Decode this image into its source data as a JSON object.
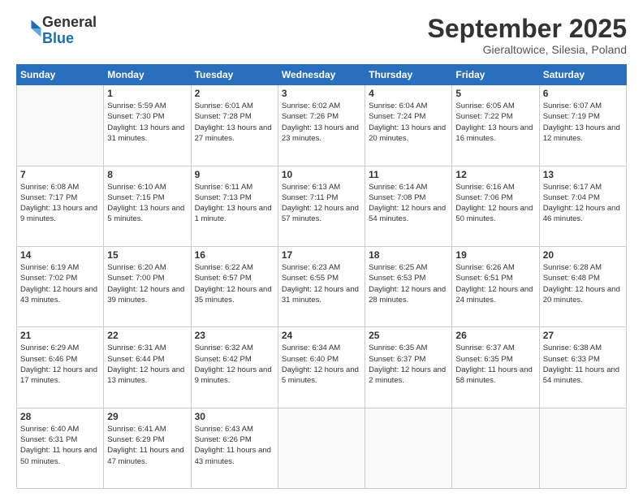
{
  "logo": {
    "text1": "General",
    "text2": "Blue"
  },
  "header": {
    "month": "September 2025",
    "location": "Gieraltowice, Silesia, Poland"
  },
  "weekdays": [
    "Sunday",
    "Monday",
    "Tuesday",
    "Wednesday",
    "Thursday",
    "Friday",
    "Saturday"
  ],
  "weeks": [
    [
      {
        "day": "",
        "sunrise": "",
        "sunset": "",
        "daylight": ""
      },
      {
        "day": "1",
        "sunrise": "Sunrise: 5:59 AM",
        "sunset": "Sunset: 7:30 PM",
        "daylight": "Daylight: 13 hours and 31 minutes."
      },
      {
        "day": "2",
        "sunrise": "Sunrise: 6:01 AM",
        "sunset": "Sunset: 7:28 PM",
        "daylight": "Daylight: 13 hours and 27 minutes."
      },
      {
        "day": "3",
        "sunrise": "Sunrise: 6:02 AM",
        "sunset": "Sunset: 7:26 PM",
        "daylight": "Daylight: 13 hours and 23 minutes."
      },
      {
        "day": "4",
        "sunrise": "Sunrise: 6:04 AM",
        "sunset": "Sunset: 7:24 PM",
        "daylight": "Daylight: 13 hours and 20 minutes."
      },
      {
        "day": "5",
        "sunrise": "Sunrise: 6:05 AM",
        "sunset": "Sunset: 7:22 PM",
        "daylight": "Daylight: 13 hours and 16 minutes."
      },
      {
        "day": "6",
        "sunrise": "Sunrise: 6:07 AM",
        "sunset": "Sunset: 7:19 PM",
        "daylight": "Daylight: 13 hours and 12 minutes."
      }
    ],
    [
      {
        "day": "7",
        "sunrise": "Sunrise: 6:08 AM",
        "sunset": "Sunset: 7:17 PM",
        "daylight": "Daylight: 13 hours and 9 minutes."
      },
      {
        "day": "8",
        "sunrise": "Sunrise: 6:10 AM",
        "sunset": "Sunset: 7:15 PM",
        "daylight": "Daylight: 13 hours and 5 minutes."
      },
      {
        "day": "9",
        "sunrise": "Sunrise: 6:11 AM",
        "sunset": "Sunset: 7:13 PM",
        "daylight": "Daylight: 13 hours and 1 minute."
      },
      {
        "day": "10",
        "sunrise": "Sunrise: 6:13 AM",
        "sunset": "Sunset: 7:11 PM",
        "daylight": "Daylight: 12 hours and 57 minutes."
      },
      {
        "day": "11",
        "sunrise": "Sunrise: 6:14 AM",
        "sunset": "Sunset: 7:08 PM",
        "daylight": "Daylight: 12 hours and 54 minutes."
      },
      {
        "day": "12",
        "sunrise": "Sunrise: 6:16 AM",
        "sunset": "Sunset: 7:06 PM",
        "daylight": "Daylight: 12 hours and 50 minutes."
      },
      {
        "day": "13",
        "sunrise": "Sunrise: 6:17 AM",
        "sunset": "Sunset: 7:04 PM",
        "daylight": "Daylight: 12 hours and 46 minutes."
      }
    ],
    [
      {
        "day": "14",
        "sunrise": "Sunrise: 6:19 AM",
        "sunset": "Sunset: 7:02 PM",
        "daylight": "Daylight: 12 hours and 43 minutes."
      },
      {
        "day": "15",
        "sunrise": "Sunrise: 6:20 AM",
        "sunset": "Sunset: 7:00 PM",
        "daylight": "Daylight: 12 hours and 39 minutes."
      },
      {
        "day": "16",
        "sunrise": "Sunrise: 6:22 AM",
        "sunset": "Sunset: 6:57 PM",
        "daylight": "Daylight: 12 hours and 35 minutes."
      },
      {
        "day": "17",
        "sunrise": "Sunrise: 6:23 AM",
        "sunset": "Sunset: 6:55 PM",
        "daylight": "Daylight: 12 hours and 31 minutes."
      },
      {
        "day": "18",
        "sunrise": "Sunrise: 6:25 AM",
        "sunset": "Sunset: 6:53 PM",
        "daylight": "Daylight: 12 hours and 28 minutes."
      },
      {
        "day": "19",
        "sunrise": "Sunrise: 6:26 AM",
        "sunset": "Sunset: 6:51 PM",
        "daylight": "Daylight: 12 hours and 24 minutes."
      },
      {
        "day": "20",
        "sunrise": "Sunrise: 6:28 AM",
        "sunset": "Sunset: 6:48 PM",
        "daylight": "Daylight: 12 hours and 20 minutes."
      }
    ],
    [
      {
        "day": "21",
        "sunrise": "Sunrise: 6:29 AM",
        "sunset": "Sunset: 6:46 PM",
        "daylight": "Daylight: 12 hours and 17 minutes."
      },
      {
        "day": "22",
        "sunrise": "Sunrise: 6:31 AM",
        "sunset": "Sunset: 6:44 PM",
        "daylight": "Daylight: 12 hours and 13 minutes."
      },
      {
        "day": "23",
        "sunrise": "Sunrise: 6:32 AM",
        "sunset": "Sunset: 6:42 PM",
        "daylight": "Daylight: 12 hours and 9 minutes."
      },
      {
        "day": "24",
        "sunrise": "Sunrise: 6:34 AM",
        "sunset": "Sunset: 6:40 PM",
        "daylight": "Daylight: 12 hours and 5 minutes."
      },
      {
        "day": "25",
        "sunrise": "Sunrise: 6:35 AM",
        "sunset": "Sunset: 6:37 PM",
        "daylight": "Daylight: 12 hours and 2 minutes."
      },
      {
        "day": "26",
        "sunrise": "Sunrise: 6:37 AM",
        "sunset": "Sunset: 6:35 PM",
        "daylight": "Daylight: 11 hours and 58 minutes."
      },
      {
        "day": "27",
        "sunrise": "Sunrise: 6:38 AM",
        "sunset": "Sunset: 6:33 PM",
        "daylight": "Daylight: 11 hours and 54 minutes."
      }
    ],
    [
      {
        "day": "28",
        "sunrise": "Sunrise: 6:40 AM",
        "sunset": "Sunset: 6:31 PM",
        "daylight": "Daylight: 11 hours and 50 minutes."
      },
      {
        "day": "29",
        "sunrise": "Sunrise: 6:41 AM",
        "sunset": "Sunset: 6:29 PM",
        "daylight": "Daylight: 11 hours and 47 minutes."
      },
      {
        "day": "30",
        "sunrise": "Sunrise: 6:43 AM",
        "sunset": "Sunset: 6:26 PM",
        "daylight": "Daylight: 11 hours and 43 minutes."
      },
      {
        "day": "",
        "sunrise": "",
        "sunset": "",
        "daylight": ""
      },
      {
        "day": "",
        "sunrise": "",
        "sunset": "",
        "daylight": ""
      },
      {
        "day": "",
        "sunrise": "",
        "sunset": "",
        "daylight": ""
      },
      {
        "day": "",
        "sunrise": "",
        "sunset": "",
        "daylight": ""
      }
    ]
  ]
}
